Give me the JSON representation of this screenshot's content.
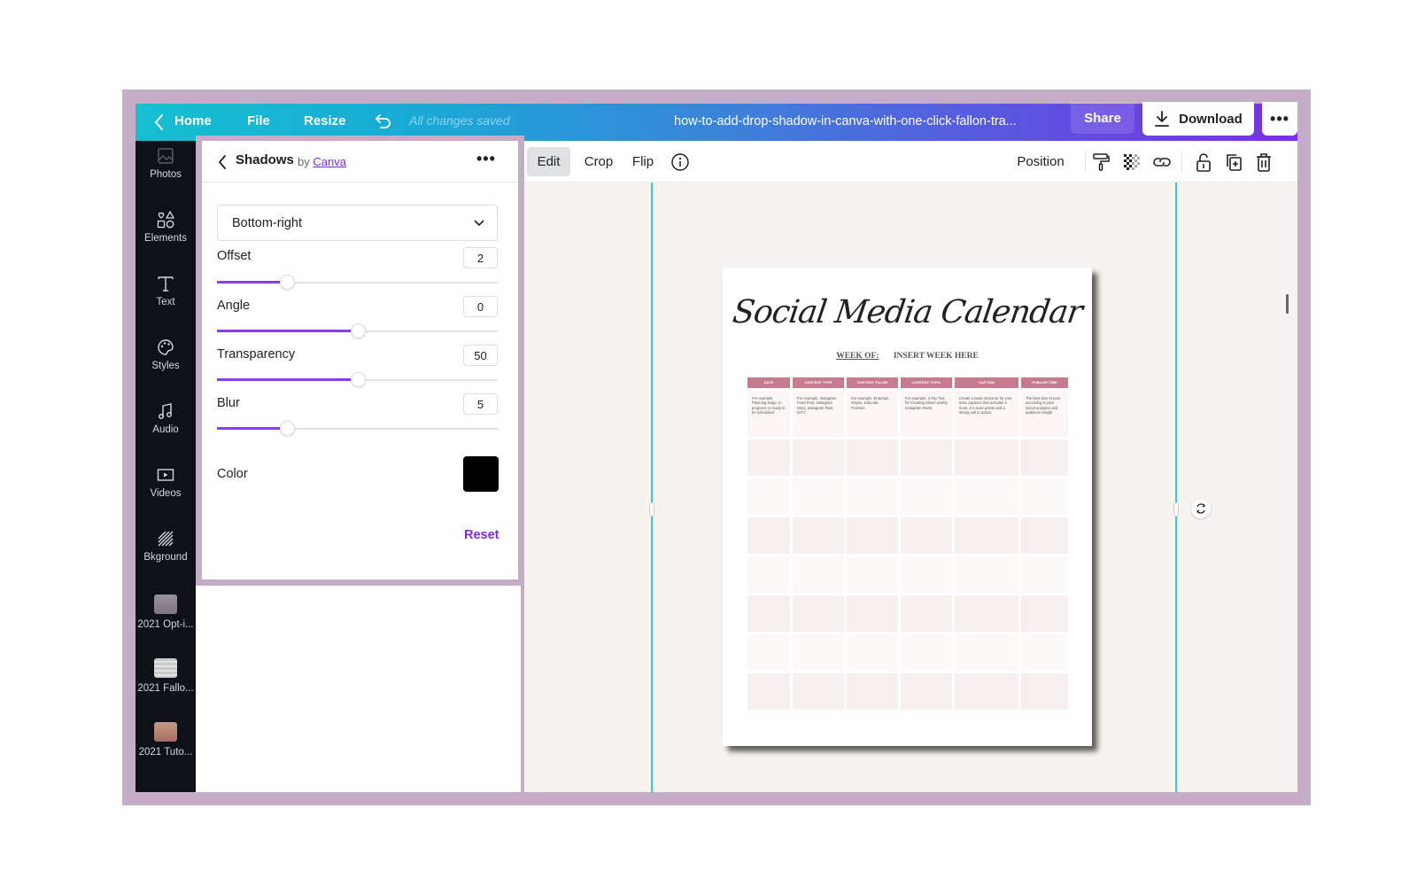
{
  "header": {
    "back_icon": "chevron-left-icon",
    "home_label": "Home",
    "file_label": "File",
    "resize_label": "Resize",
    "undo_icon": "undo-icon",
    "save_status": "All changes saved",
    "document_title": "how-to-add-drop-shadow-in-canva-with-one-click-fallon-tra...",
    "share_label": "Share",
    "download_label": "Download",
    "download_icon": "download-icon",
    "more_icon": "more-horizontal-icon",
    "gradient_start": "#15bfd0",
    "gradient_end": "#7b2fe6"
  },
  "sidebar": {
    "items": [
      {
        "label": "Photos",
        "icon": "photo-icon"
      },
      {
        "label": "Elements",
        "icon": "shapes-icon"
      },
      {
        "label": "Text",
        "icon": "text-icon"
      },
      {
        "label": "Styles",
        "icon": "palette-icon"
      },
      {
        "label": "Audio",
        "icon": "music-note-icon"
      },
      {
        "label": "Videos",
        "icon": "video-icon"
      },
      {
        "label": "Bkground",
        "icon": "background-hatch-icon"
      },
      {
        "label": "2021 Opt-i...",
        "icon": "folder-thumbnail"
      },
      {
        "label": "2021 Fallo...",
        "icon": "folder-thumbnail"
      },
      {
        "label": "2021 Tuto...",
        "icon": "folder-thumbnail"
      }
    ]
  },
  "shadows_panel": {
    "title": "Shadows",
    "by_prefix": "by",
    "by_link": "Canva",
    "preset": "Bottom-right",
    "controls": [
      {
        "label": "Offset",
        "value": "2",
        "slider_fraction": 0.25
      },
      {
        "label": "Angle",
        "value": "0",
        "slider_fraction": 0.5
      },
      {
        "label": "Transparency",
        "value": "50",
        "slider_fraction": 0.5
      },
      {
        "label": "Blur",
        "value": "5",
        "slider_fraction": 0.25
      }
    ],
    "color_label": "Color",
    "color_value": "#000000",
    "reset_label": "Reset",
    "accent": "#7d2ae8"
  },
  "toolbar": {
    "edit_label": "Edit",
    "crop_label": "Crop",
    "flip_label": "Flip",
    "info_icon": "info-icon",
    "position_label": "Position",
    "icons": [
      "paint-roller-icon",
      "transparency-icon",
      "link-icon",
      "lock-icon",
      "duplicate-icon",
      "trash-icon"
    ]
  },
  "design": {
    "title": "Social Media Calendar",
    "week_label": "WEEK OF:",
    "week_value": "INSERT WEEK HERE",
    "columns": [
      "DATE",
      "CONTENT TYPE",
      "CONTENT PILLAR",
      "CONTENT TOPIC",
      "CAPTION",
      "PUBLISH TIME"
    ],
    "example_row": [
      "For example, Planning stage, In progress or ready to be scheduled",
      "For example, Instagram Feed Post, Instagram Story, Instagram Reel, IGTV",
      "For example, Entertain, Inspire, Educate, Promote",
      "For example, 3 Top Tips for Creating Share-worthy Instagram Reels",
      "Create a basic structure for your insta captions that includes a hook, 2-3 main points and a strong call to action.",
      "The best time to post according to your social analytics and audience insight"
    ],
    "empty_rows": 7,
    "header_color": "#c67b8e"
  }
}
